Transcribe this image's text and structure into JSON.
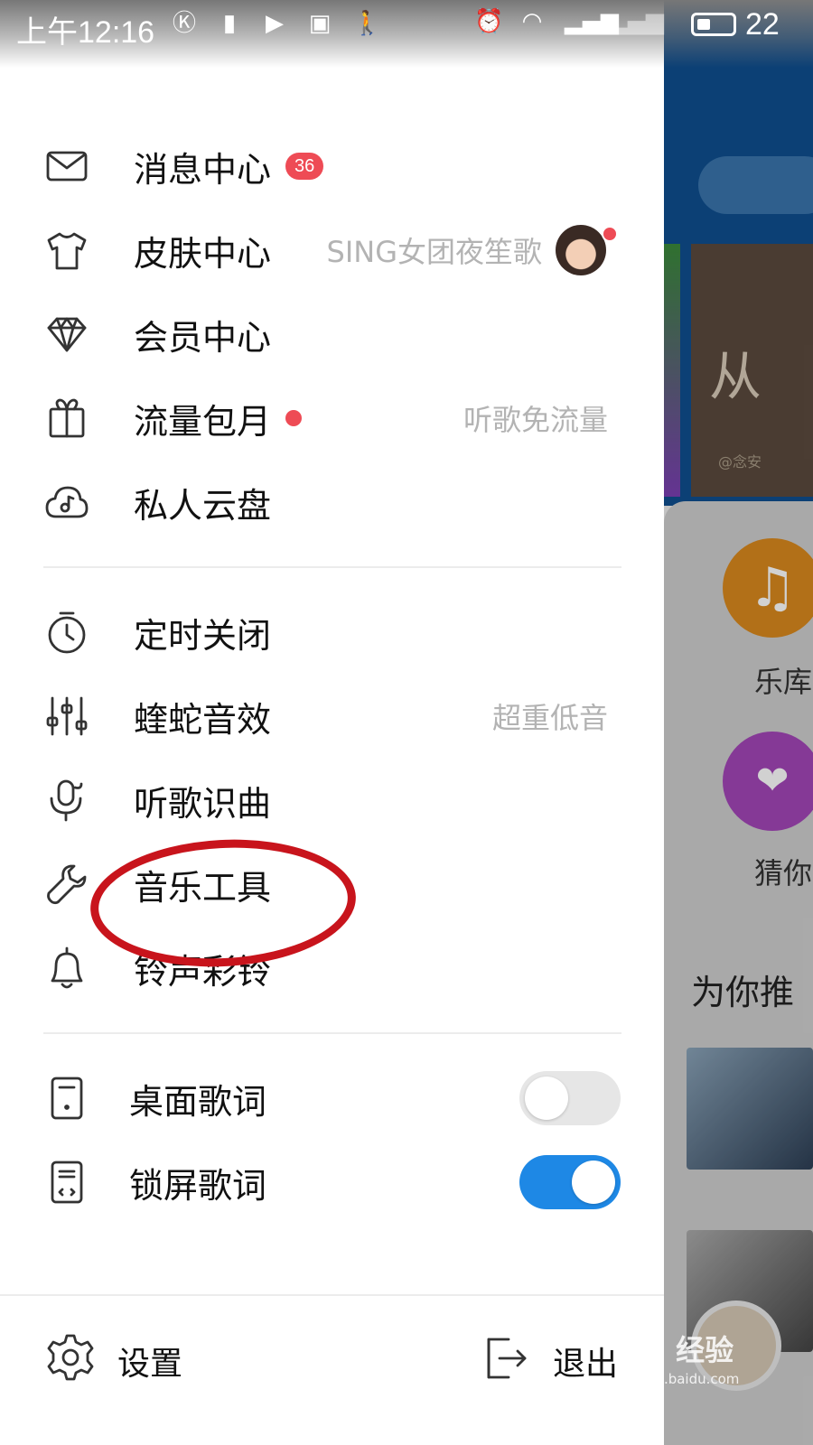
{
  "status_bar": {
    "time": "上午12:16",
    "battery": "22"
  },
  "drawer": {
    "group1": [
      {
        "label": "消息中心",
        "badge": "36"
      },
      {
        "label": "皮肤中心",
        "right": "SING女团夜笙歌"
      },
      {
        "label": "会员中心"
      },
      {
        "label": "流量包月",
        "right": "听歌免流量"
      },
      {
        "label": "私人云盘"
      }
    ],
    "group2": [
      {
        "label": "定时关闭"
      },
      {
        "label": "蝰蛇音效",
        "right": "超重低音"
      },
      {
        "label": "听歌识曲"
      },
      {
        "label": "音乐工具"
      },
      {
        "label": "铃声彩铃"
      }
    ],
    "group3": [
      {
        "label": "桌面歌词",
        "toggle": "off"
      },
      {
        "label": "锁屏歌词",
        "toggle": "on"
      }
    ],
    "bottom": {
      "settings": "设置",
      "exit": "退出"
    }
  },
  "background": {
    "banner_text": "从",
    "banner_sub": "@念安",
    "btn1_label": "乐库",
    "btn2_label": "猜你喜",
    "section_title": "为你推"
  },
  "watermark": {
    "main": "Bai 经验",
    "sub": "jingyan.baidu.com"
  },
  "colors": {
    "accent": "#1e88e5",
    "badge": "#ee4b55",
    "annotation": "#c8141c"
  }
}
